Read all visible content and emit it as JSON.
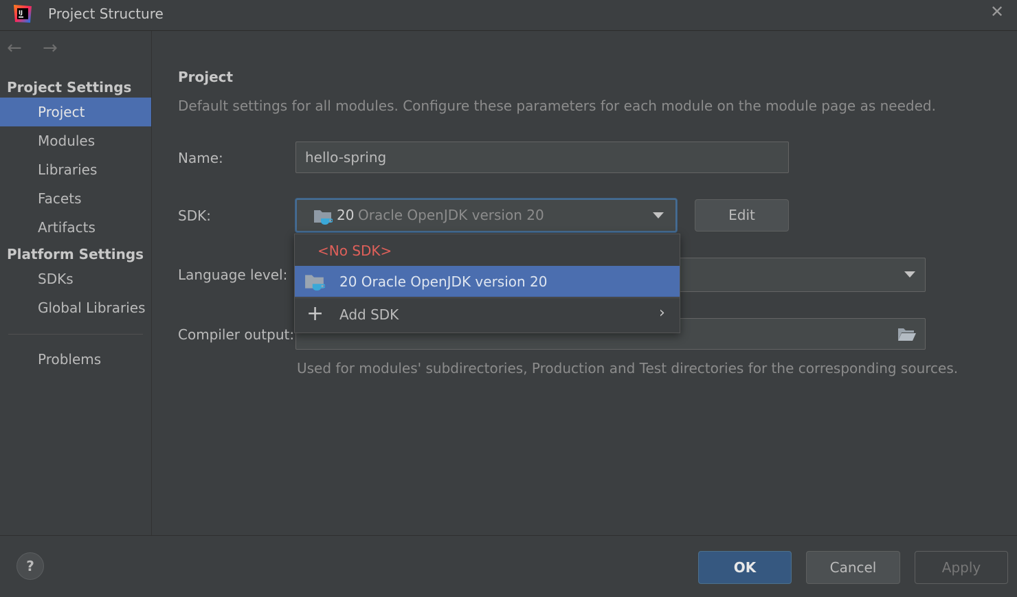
{
  "window": {
    "title": "Project Structure"
  },
  "icons": {
    "app_logo": "intellij-logo-icon",
    "close": "close-icon",
    "back": "back-arrow-icon",
    "forward": "forward-arrow-icon",
    "jdk": "jdk-folder-icon",
    "add": "plus-icon",
    "submenu": "chevron-right-icon",
    "browse": "folder-open-icon",
    "help": "help-icon"
  },
  "nav": {
    "back_glyph": "←",
    "forward_glyph": "→"
  },
  "sidebar": {
    "project_settings_header": "Project Settings",
    "project_items": [
      "Project",
      "Modules",
      "Libraries",
      "Facets",
      "Artifacts"
    ],
    "platform_settings_header": "Platform Settings",
    "platform_items": [
      "SDKs",
      "Global Libraries"
    ],
    "problems": "Problems",
    "selected": "Project"
  },
  "main": {
    "heading": "Project",
    "description": "Default settings for all modules. Configure these parameters for each module on the module page as needed.",
    "name_label": "Name:",
    "name_value": "hello-spring",
    "sdk_label": "SDK:",
    "sdk_version": "20",
    "sdk_name": "Oracle OpenJDK version 20",
    "edit_button": "Edit",
    "language_level_label": "Language level:",
    "compiler_output_label": "Compiler output:",
    "compiler_output_value": "",
    "compiler_hint": "Used for modules' subdirectories, Production and Test directories for the corresponding sources."
  },
  "sdk_popup": {
    "no_sdk": "<No SDK>",
    "jdk_item": "20 Oracle OpenJDK version 20",
    "add_sdk": "Add SDK"
  },
  "buttons": {
    "help": "?",
    "ok": "OK",
    "cancel": "Cancel",
    "apply": "Apply"
  },
  "colors": {
    "background": "#3c3f41",
    "selection": "#4b6eaf",
    "primary_button": "#365880",
    "no_sdk_text": "#e0605a",
    "focus_border": "#466d94"
  }
}
